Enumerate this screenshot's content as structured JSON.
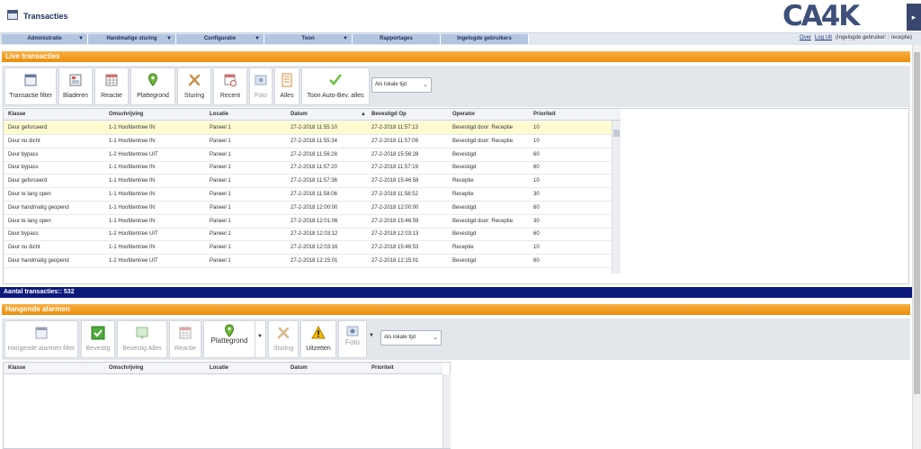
{
  "app": {
    "title": "Transacties",
    "logo_text": "CA4K"
  },
  "menu": [
    {
      "label": "Administratie",
      "has_arrow": true
    },
    {
      "label": "Handmatige sturing",
      "has_arrow": true
    },
    {
      "label": "Configuratie",
      "has_arrow": true
    },
    {
      "label": "Toon",
      "has_arrow": true
    },
    {
      "label": "Rapportages",
      "has_arrow": false
    },
    {
      "label": "Ingelogde gebruikers",
      "has_arrow": false
    }
  ],
  "userlinks": {
    "over": "Over",
    "logout": "Log Uit",
    "user_info": "(Ingelogde gebruiker: : receptie)"
  },
  "live": {
    "header": "Live transacties",
    "toolbar": {
      "buttons": [
        {
          "label": "Transactie filter",
          "icon": "window-icon"
        },
        {
          "label": "Bladeren",
          "icon": "browse-icon"
        },
        {
          "label": "Reactie",
          "icon": "grid-icon"
        },
        {
          "label": "Plattegrond",
          "icon": "map-pin-icon"
        },
        {
          "label": "Sturing",
          "icon": "tools-icon"
        },
        {
          "label": "Recent",
          "icon": "recent-icon"
        },
        {
          "label": "Foto",
          "icon": "photo-icon"
        },
        {
          "label": "Alles",
          "icon": "list-icon"
        },
        {
          "label": "Toon Auto-Bev. alles",
          "icon": "check-icon"
        }
      ],
      "timezone": "Als lokale tijd"
    },
    "columns": [
      "Klasse",
      "Omschrijving",
      "Locatie",
      "Datum",
      "Bevestigd Op",
      "Operator",
      "Prioriteit"
    ],
    "rows": [
      [
        "Deur geforceerd",
        "1-1 Hoofdentree IN",
        "Paneel 1",
        "27-2-2018 11:55:10",
        "27-2-2018 11:57:13",
        "Bevestigd door: Receptie",
        "10"
      ],
      [
        "Deur nu dicht",
        "1-1 Hoofdentree IN",
        "Paneel 1",
        "27-2-2018 11:55:34",
        "27-2-2018 11:57:09",
        "Bevestigd door: Receptie",
        "10"
      ],
      [
        "Deur bypass",
        "1-2 Hoofdentree UIT",
        "Paneel 1",
        "27-2-2018 11:56:28",
        "27-2-2018 15:56:28",
        "Bevestigd",
        "60"
      ],
      [
        "Deur bypass",
        "1-1 Hoofdentree IN",
        "Paneel 1",
        "27-2-2018 11:57:20",
        "27-2-2018 11:57:19",
        "Bevestigd",
        "60"
      ],
      [
        "Deur geforceerd",
        "1-1 Hoofdentree IN",
        "Paneel 1",
        "27-2-2018 11:57:36",
        "27-2-2018 15:46:58",
        "Receptie",
        "10"
      ],
      [
        "Deur te lang open",
        "1-1 Hoofdentree IN",
        "Paneel 1",
        "27-2-2018 11:58:06",
        "27-2-2018 11:58:52",
        "Receptie",
        "30"
      ],
      [
        "Deur handmatig geopend",
        "1-1 Hoofdentree IN",
        "Paneel 1",
        "27-2-2018 12:00:00",
        "27-2-2018 12:00:00",
        "Bevestigd",
        "60"
      ],
      [
        "Deur te lang open",
        "1-1 Hoofdentree IN",
        "Paneel 1",
        "27-2-2018 12:01:06",
        "27-2-2018 15:46:59",
        "Bevestigd door: Receptie",
        "30"
      ],
      [
        "Deur bypass",
        "1-2 Hoofdentree UIT",
        "Paneel 1",
        "27-2-2018 12:03:12",
        "27-2-2018 12:03:13",
        "Bevestigd",
        "60"
      ],
      [
        "Deur nu dicht",
        "1-1 Hoofdentree IN",
        "Paneel 1",
        "27-2-2018 12:03:16",
        "27-2-2018 15:46:53",
        "Receptie",
        "10"
      ],
      [
        "Deur handmatig geopend",
        "1-2 Hoofdentree UIT",
        "Paneel 1",
        "27-2-2018 12:15:01",
        "27-2-2018 12:15:01",
        "Bevestigd",
        "60"
      ]
    ],
    "count_text": "Aantal transacties:: 532"
  },
  "alarms": {
    "header": "Hangende alarmen",
    "toolbar": {
      "buttons": [
        {
          "label": "Hangende alarmen filter",
          "icon": "window-icon"
        },
        {
          "label": "Bevestig",
          "icon": "confirm-icon"
        },
        {
          "label": "Bevestig Alles",
          "icon": "confirm-all-icon"
        },
        {
          "label": "Reactie",
          "icon": "grid-icon"
        },
        {
          "label": "Plattegrond",
          "icon": "map-pin-icon"
        },
        {
          "label": "Sturing",
          "icon": "tools-icon"
        },
        {
          "label": "Uitzetten",
          "icon": "warning-icon"
        },
        {
          "label": "Foto",
          "icon": "photo-icon"
        }
      ],
      "timezone": "Als lokale tijd"
    },
    "columns": [
      "Klasse",
      "Omschrijving",
      "Locatie",
      "Datum",
      "Prioriteit"
    ]
  },
  "colors": {
    "accent": "#f39c12",
    "navy": "#0b1a7a",
    "menu": "#b3c6e0",
    "selected_row": "#fffbd0"
  }
}
